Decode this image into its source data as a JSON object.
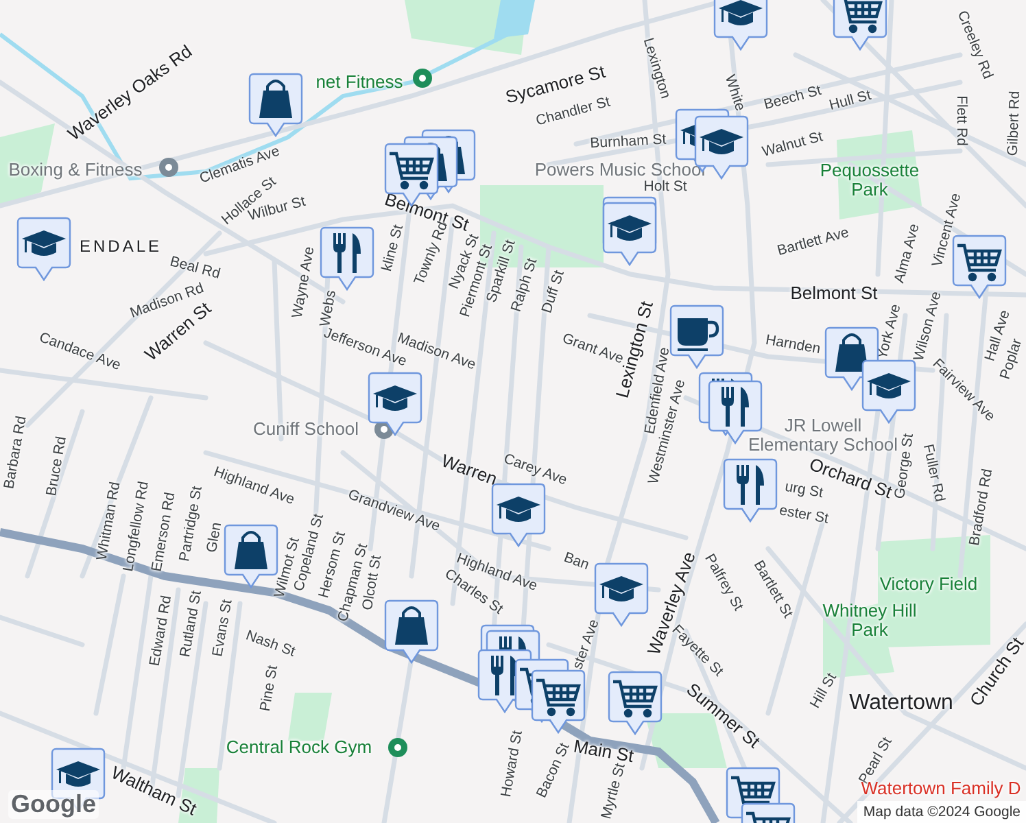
{
  "map": {
    "labels": [
      {
        "text": "net Fitness",
        "kind": "poi-green"
      },
      {
        "text": "Boxing & Fitness",
        "kind": "poi-gray"
      },
      {
        "text": "Waverley Oaks Rd",
        "kind": "major"
      },
      {
        "text": "Sycamore St",
        "kind": "major"
      },
      {
        "text": "Chandler St",
        "kind": "street"
      },
      {
        "text": "Lexington",
        "kind": "street"
      },
      {
        "text": "White",
        "kind": "street"
      },
      {
        "text": "Beech St",
        "kind": "street"
      },
      {
        "text": "Hull St",
        "kind": "street"
      },
      {
        "text": "Burnham St",
        "kind": "street"
      },
      {
        "text": "Walnut St",
        "kind": "street"
      },
      {
        "text": "Powers Music School",
        "kind": "place"
      },
      {
        "text": "Holt St",
        "kind": "street"
      },
      {
        "text": "Pequossette Park",
        "kind": "park"
      },
      {
        "text": "Creeley Rd",
        "kind": "street"
      },
      {
        "text": "Flett Rd",
        "kind": "street"
      },
      {
        "text": "Gilbert Rd",
        "kind": "street"
      },
      {
        "text": "Clematis Ave",
        "kind": "street"
      },
      {
        "text": "Hollace St",
        "kind": "street"
      },
      {
        "text": "Wilbur St",
        "kind": "street"
      },
      {
        "text": "Belmont St",
        "kind": "major"
      },
      {
        "text": "ENDALE",
        "kind": "district"
      },
      {
        "text": "Beal Rd",
        "kind": "street"
      },
      {
        "text": "Wayne Ave",
        "kind": "street"
      },
      {
        "text": "Webs",
        "kind": "street"
      },
      {
        "text": "kline St",
        "kind": "street"
      },
      {
        "text": "Townly Rd",
        "kind": "street"
      },
      {
        "text": "Nyack St",
        "kind": "street"
      },
      {
        "text": "Piermont St",
        "kind": "street"
      },
      {
        "text": "Sparkill St",
        "kind": "street"
      },
      {
        "text": "Ralph St",
        "kind": "street"
      },
      {
        "text": "Duff St",
        "kind": "street"
      },
      {
        "text": "Bartlett Ave",
        "kind": "street"
      },
      {
        "text": "Alma Ave",
        "kind": "street"
      },
      {
        "text": "Vincent Ave",
        "kind": "street"
      },
      {
        "text": "Belmont St",
        "kind": "major"
      },
      {
        "text": "Madison Rd",
        "kind": "street"
      },
      {
        "text": "Warren St",
        "kind": "major"
      },
      {
        "text": "Candace Ave",
        "kind": "street"
      },
      {
        "text": "Jefferson Ave",
        "kind": "street"
      },
      {
        "text": "Madison Ave",
        "kind": "street"
      },
      {
        "text": "Grant Ave",
        "kind": "street"
      },
      {
        "text": "Lexington St",
        "kind": "major"
      },
      {
        "text": "Harnden",
        "kind": "street"
      },
      {
        "text": "York Ave",
        "kind": "street"
      },
      {
        "text": "Wilson Ave",
        "kind": "street"
      },
      {
        "text": "Fairview Ave",
        "kind": "street"
      },
      {
        "text": "Hall Ave",
        "kind": "street"
      },
      {
        "text": "Poplar",
        "kind": "street"
      },
      {
        "text": "Edenfield Ave",
        "kind": "street"
      },
      {
        "text": "Westminster Ave",
        "kind": "street"
      },
      {
        "text": "Cuniff School",
        "kind": "place"
      },
      {
        "text": "JR Lowell Elementary School",
        "kind": "place"
      },
      {
        "text": "Orchard St",
        "kind": "major"
      },
      {
        "text": "George St",
        "kind": "street"
      },
      {
        "text": "Fuller Rd",
        "kind": "street"
      },
      {
        "text": "Bradford Rd",
        "kind": "street"
      },
      {
        "text": "Carey Ave",
        "kind": "street"
      },
      {
        "text": "Warren",
        "kind": "major"
      },
      {
        "text": "Barbara Rd",
        "kind": "street"
      },
      {
        "text": "Bruce Rd",
        "kind": "street"
      },
      {
        "text": "Highland Ave",
        "kind": "street"
      },
      {
        "text": "Grandview Ave",
        "kind": "street"
      },
      {
        "text": "urg St",
        "kind": "street"
      },
      {
        "text": "ester St",
        "kind": "street"
      },
      {
        "text": "Whitman Rd",
        "kind": "street"
      },
      {
        "text": "Longfellow Rd",
        "kind": "street"
      },
      {
        "text": "Emerson Rd",
        "kind": "street"
      },
      {
        "text": "Partridge St",
        "kind": "street"
      },
      {
        "text": "Glen",
        "kind": "street"
      },
      {
        "text": "Wilmot St",
        "kind": "street"
      },
      {
        "text": "Copeland St",
        "kind": "street"
      },
      {
        "text": "Hersom St",
        "kind": "street"
      },
      {
        "text": "Chapman St",
        "kind": "street"
      },
      {
        "text": "Olcott St",
        "kind": "street"
      },
      {
        "text": "Highland Ave",
        "kind": "street"
      },
      {
        "text": "Charles St",
        "kind": "street"
      },
      {
        "text": "Ban",
        "kind": "street"
      },
      {
        "text": "ster Ave",
        "kind": "street"
      },
      {
        "text": "Edward Rd",
        "kind": "street"
      },
      {
        "text": "Rutland St",
        "kind": "street"
      },
      {
        "text": "Evans St",
        "kind": "street"
      },
      {
        "text": "Nash St",
        "kind": "street"
      },
      {
        "text": "Pine St",
        "kind": "street"
      },
      {
        "text": "Central Rock Gym",
        "kind": "poi-green"
      },
      {
        "text": "Waltham St",
        "kind": "major"
      },
      {
        "text": "Howard St",
        "kind": "street"
      },
      {
        "text": "Bacon St",
        "kind": "street"
      },
      {
        "text": "Main St",
        "kind": "major"
      },
      {
        "text": "Myrtle St",
        "kind": "street"
      },
      {
        "text": "Waverley Ave",
        "kind": "major"
      },
      {
        "text": "Palfrey St",
        "kind": "street"
      },
      {
        "text": "Bartlett St",
        "kind": "street"
      },
      {
        "text": "Fayette St",
        "kind": "street"
      },
      {
        "text": "Summer St",
        "kind": "major"
      },
      {
        "text": "Hill St",
        "kind": "street"
      },
      {
        "text": "Pearl St",
        "kind": "street"
      },
      {
        "text": "Church St",
        "kind": "major"
      },
      {
        "text": "Victory Field",
        "kind": "park"
      },
      {
        "text": "Whitney Hill Park",
        "kind": "park"
      },
      {
        "text": "Watertown",
        "kind": "town"
      },
      {
        "text": "Watertown Family D",
        "kind": "poi-red"
      }
    ],
    "markers": [
      {
        "kind": "school"
      },
      {
        "kind": "cart"
      },
      {
        "kind": "shopping"
      },
      {
        "kind": "shopping"
      },
      {
        "kind": "shopping"
      },
      {
        "kind": "cart"
      },
      {
        "kind": "school"
      },
      {
        "kind": "school"
      },
      {
        "kind": "school"
      },
      {
        "kind": "school"
      },
      {
        "kind": "restaurant"
      },
      {
        "kind": "school"
      },
      {
        "kind": "cart"
      },
      {
        "kind": "cafe"
      },
      {
        "kind": "restaurant"
      },
      {
        "kind": "restaurant"
      },
      {
        "kind": "shopping"
      },
      {
        "kind": "school"
      },
      {
        "kind": "school"
      },
      {
        "kind": "restaurant"
      },
      {
        "kind": "school"
      },
      {
        "kind": "shopping"
      },
      {
        "kind": "school"
      },
      {
        "kind": "shopping"
      },
      {
        "kind": "restaurant"
      },
      {
        "kind": "restaurant"
      },
      {
        "kind": "restaurant"
      },
      {
        "kind": "cart"
      },
      {
        "kind": "cart"
      },
      {
        "kind": "cart"
      },
      {
        "kind": "cart"
      },
      {
        "kind": "cart"
      },
      {
        "kind": "school"
      }
    ],
    "logo": "Google",
    "attribution": "Map data ©2024 Google"
  }
}
